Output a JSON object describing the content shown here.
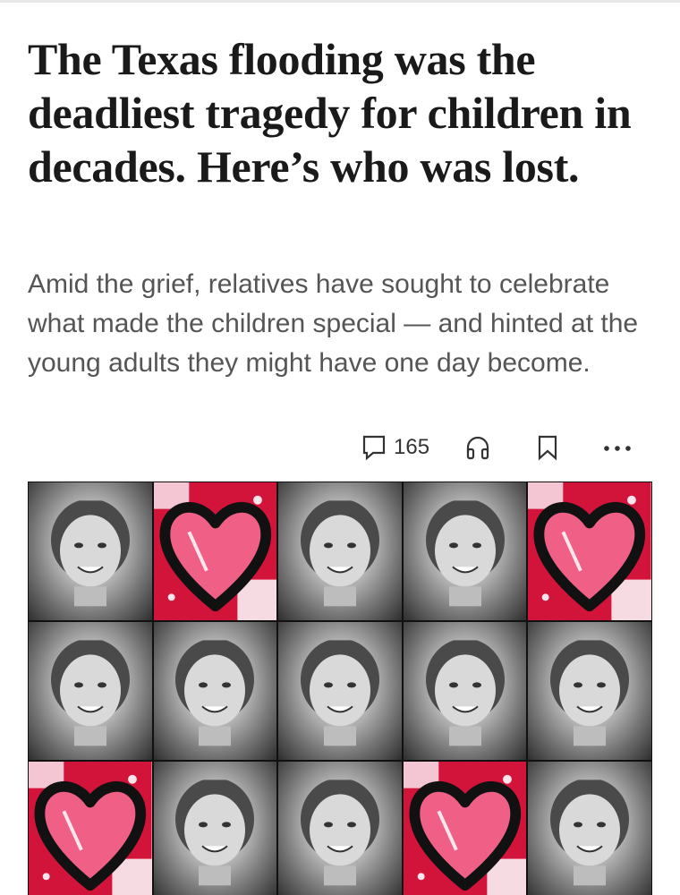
{
  "article": {
    "headline": "The Texas flooding was the deadliest tragedy for children in decades. Here’s who was lost.",
    "dek": "Amid the grief, relatives have sought to celebrate what made the children special — and hinted at the young adults they might have one day become."
  },
  "toolbar": {
    "comment_count": "165",
    "icons": [
      "comment-icon",
      "headphones-icon",
      "bookmark-icon",
      "more-icon"
    ]
  },
  "collage": {
    "rows": 3,
    "columns": 5,
    "tiles": [
      "photo",
      "heart",
      "photo",
      "photo",
      "heart",
      "photo",
      "photo",
      "photo",
      "photo",
      "photo",
      "heart",
      "photo",
      "photo",
      "heart",
      "photo"
    ],
    "colors": {
      "heart_red": "#d3143a",
      "heart_pink": "#ef5f86",
      "heart_outline": "#111111"
    }
  }
}
